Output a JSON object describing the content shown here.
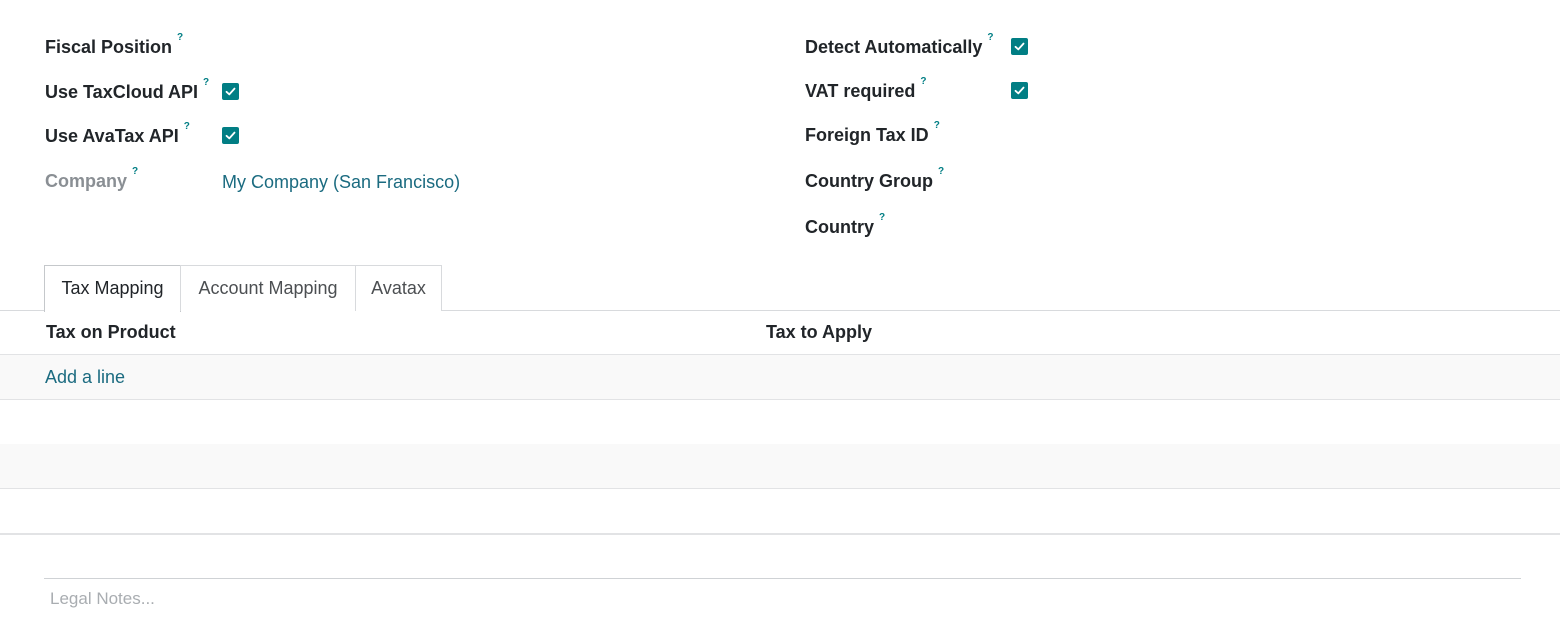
{
  "left_fields": [
    {
      "label": "Fiscal Position",
      "help": "?"
    },
    {
      "label": "Use TaxCloud API",
      "help": "?",
      "checked": true
    },
    {
      "label": "Use AvaTax API",
      "help": "?",
      "checked": true
    },
    {
      "label": "Company",
      "help": "?",
      "value": "My Company (San Francisco)"
    }
  ],
  "right_fields": [
    {
      "label": "Detect Automatically",
      "help": "?",
      "checked": true
    },
    {
      "label": "VAT required",
      "help": "?",
      "checked": true
    },
    {
      "label": "Foreign Tax ID",
      "help": "?"
    },
    {
      "label": "Country Group",
      "help": "?"
    },
    {
      "label": "Country",
      "help": "?"
    }
  ],
  "tabs": [
    {
      "label": "Tax Mapping",
      "active": true
    },
    {
      "label": "Account Mapping",
      "active": false
    },
    {
      "label": "Avatax",
      "active": false
    }
  ],
  "table": {
    "columns": [
      "Tax on Product",
      "Tax to Apply"
    ],
    "add_line_label": "Add a line",
    "empty_rows": 3
  },
  "legal_notes": {
    "placeholder": "Legal Notes..."
  },
  "colors": {
    "accent": "#017e84",
    "link": "#1b6b80"
  },
  "icons": {
    "checkbox": "checkmark-icon",
    "help": "question-mark-tooltip"
  }
}
